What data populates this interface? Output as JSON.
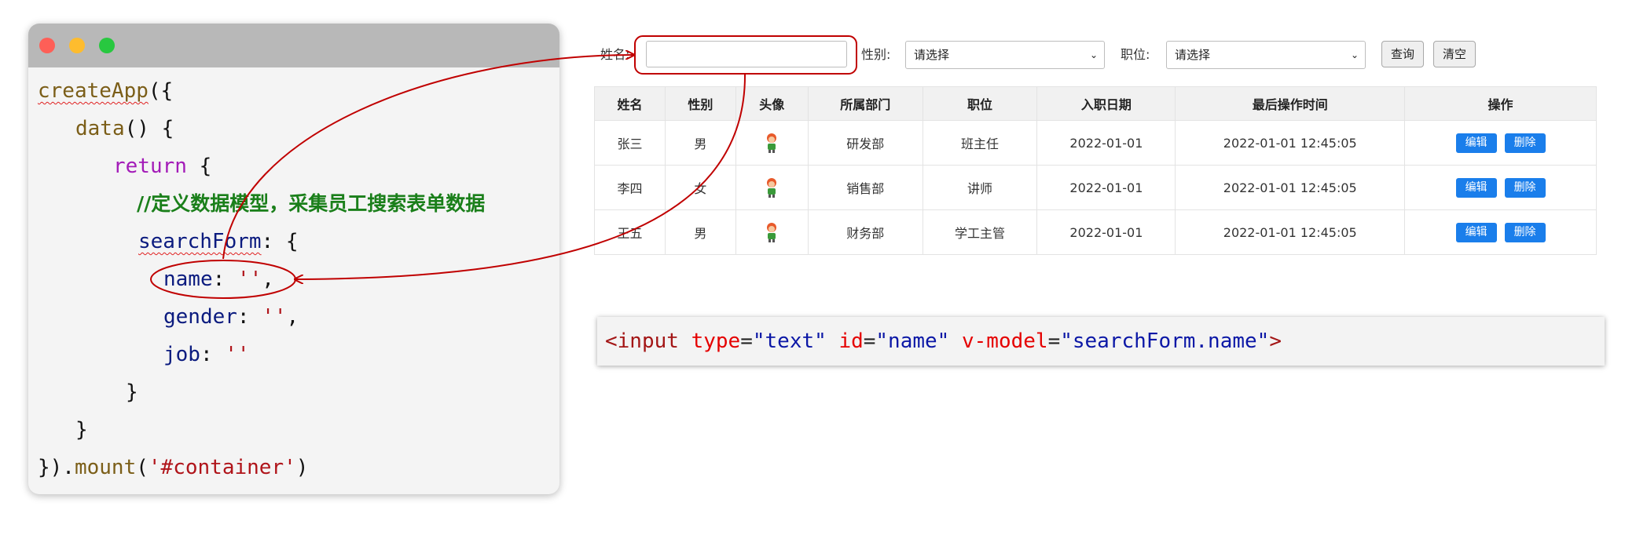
{
  "code": {
    "lines": [
      {
        "a": "createApp",
        "b": "({"
      },
      {
        "a": "data",
        "b": "() {"
      },
      {
        "a": "return",
        "b": " {"
      },
      {
        "comment": "//定义数据模型，采集员工搜索表单数据"
      },
      {
        "a": "searchForm",
        "b": ": {"
      },
      {
        "key": "name",
        "val": "''",
        "end": ","
      },
      {
        "key": "gender",
        "val": "''",
        "end": ","
      },
      {
        "key": "job",
        "val": "''",
        "end": ""
      },
      {
        "b": "}"
      },
      {
        "b": "}"
      },
      {
        "pre": "}).",
        "a": "mount",
        "b": "(",
        "val": "'#container'",
        "end": ")"
      }
    ]
  },
  "search": {
    "name_label": "姓名:",
    "name_value": "",
    "gender_label": "性别:",
    "gender_selected": "请选择",
    "job_label": "职位:",
    "job_selected": "请选择",
    "query_button": "查询",
    "clear_button": "清空"
  },
  "table": {
    "headers": [
      "姓名",
      "性别",
      "头像",
      "所属部门",
      "职位",
      "入职日期",
      "最后操作时间",
      "操作"
    ],
    "rows": [
      {
        "name": "张三",
        "gender": "男",
        "dept": "研发部",
        "job": "班主任",
        "entry": "2022-01-01",
        "updated": "2022-01-01 12:45:05"
      },
      {
        "name": "李四",
        "gender": "女",
        "dept": "销售部",
        "job": "讲师",
        "entry": "2022-01-01",
        "updated": "2022-01-01 12:45:05"
      },
      {
        "name": "王五",
        "gender": "男",
        "dept": "财务部",
        "job": "学工主管",
        "entry": "2022-01-01",
        "updated": "2022-01-01 12:45:05"
      }
    ],
    "edit_label": "编辑",
    "delete_label": "删除"
  },
  "snippet": {
    "open": "<input",
    "attr1": "type",
    "val1": "\"text\"",
    "attr2": "id",
    "val2": "\"name\"",
    "attr3": "v-model",
    "val3": "\"searchForm.name\"",
    "close": ">"
  },
  "colors": {
    "accent_button": "#1a7eeb",
    "annotation": "#c00000",
    "comment": "#1a7f1a"
  },
  "icons": [
    "avatar-icon",
    "chevron-down-icon",
    "window-close-dot",
    "window-minimize-dot",
    "window-zoom-dot"
  ]
}
